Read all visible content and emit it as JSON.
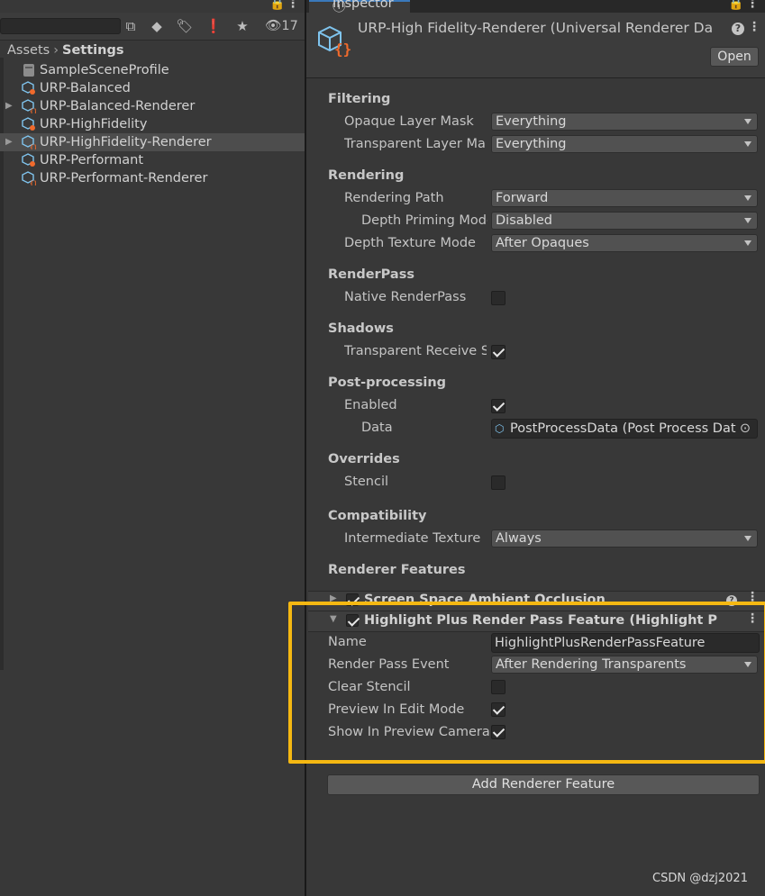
{
  "project": {
    "toolbar": {
      "hidden_count": "17"
    },
    "breadcrumb": {
      "root": "Assets",
      "current": "Settings"
    },
    "items": [
      {
        "label": "SampleSceneProfile",
        "icon": "volume-profile-icon",
        "expandable": false,
        "selected": false
      },
      {
        "label": "URP-Balanced",
        "icon": "urp-asset-icon",
        "expandable": false,
        "selected": false
      },
      {
        "label": "URP-Balanced-Renderer",
        "icon": "renderer-data-icon",
        "expandable": true,
        "selected": false
      },
      {
        "label": "URP-HighFidelity",
        "icon": "urp-asset-icon",
        "expandable": false,
        "selected": false
      },
      {
        "label": "URP-HighFidelity-Renderer",
        "icon": "renderer-data-icon",
        "expandable": true,
        "selected": true
      },
      {
        "label": "URP-Performant",
        "icon": "urp-asset-icon",
        "expandable": false,
        "selected": false
      },
      {
        "label": "URP-Performant-Renderer",
        "icon": "renderer-data-icon",
        "expandable": false,
        "selected": false
      }
    ]
  },
  "inspector": {
    "tab_label": "Inspector",
    "title": "URP-High Fidelity-Renderer (Universal Renderer Da",
    "open_label": "Open",
    "sections": {
      "filtering": {
        "title": "Filtering",
        "opaque_label": "Opaque Layer Mask",
        "opaque_value": "Everything",
        "transparent_label": "Transparent Layer Ma",
        "transparent_value": "Everything"
      },
      "rendering": {
        "title": "Rendering",
        "path_label": "Rendering Path",
        "path_value": "Forward",
        "depth_priming_label": "Depth Priming Mode",
        "depth_priming_value": "Disabled",
        "depth_texture_label": "Depth Texture Mode",
        "depth_texture_value": "After Opaques"
      },
      "renderpass": {
        "title": "RenderPass",
        "native_label": "Native RenderPass",
        "native_checked": false
      },
      "shadows": {
        "title": "Shadows",
        "transparent_receive_label": "Transparent Receive S",
        "transparent_receive_checked": true
      },
      "postprocessing": {
        "title": "Post-processing",
        "enabled_label": "Enabled",
        "enabled_checked": true,
        "data_label": "Data",
        "data_value": "PostProcessData (Post Process Dat"
      },
      "overrides": {
        "title": "Overrides",
        "stencil_label": "Stencil",
        "stencil_checked": false
      },
      "compatibility": {
        "title": "Compatibility",
        "intermediate_label": "Intermediate Texture",
        "intermediate_value": "Always"
      },
      "renderer_features": {
        "title": "Renderer Features"
      }
    },
    "features": {
      "ssao_title": "Screen Space Ambient Occlusion",
      "highlight_title": "Highlight Plus Render Pass Feature (Highlight Plus R",
      "name_label": "Name",
      "name_value": "HighlightPlusRenderPassFeature",
      "event_label": "Render Pass Event",
      "event_value": "After Rendering Transparents",
      "clear_stencil_label": "Clear Stencil",
      "clear_stencil_checked": false,
      "preview_edit_label": "Preview In Edit Mode",
      "preview_edit_checked": true,
      "preview_camera_label": "Show In Preview Camera",
      "preview_camera_checked": true
    },
    "add_feature_label": "Add Renderer Feature"
  },
  "watermark": "CSDN @dzj2021",
  "colors": {
    "highlight_box": "#f5b812",
    "panel_bg": "#383838",
    "selected_row": "#4d4d4d"
  }
}
